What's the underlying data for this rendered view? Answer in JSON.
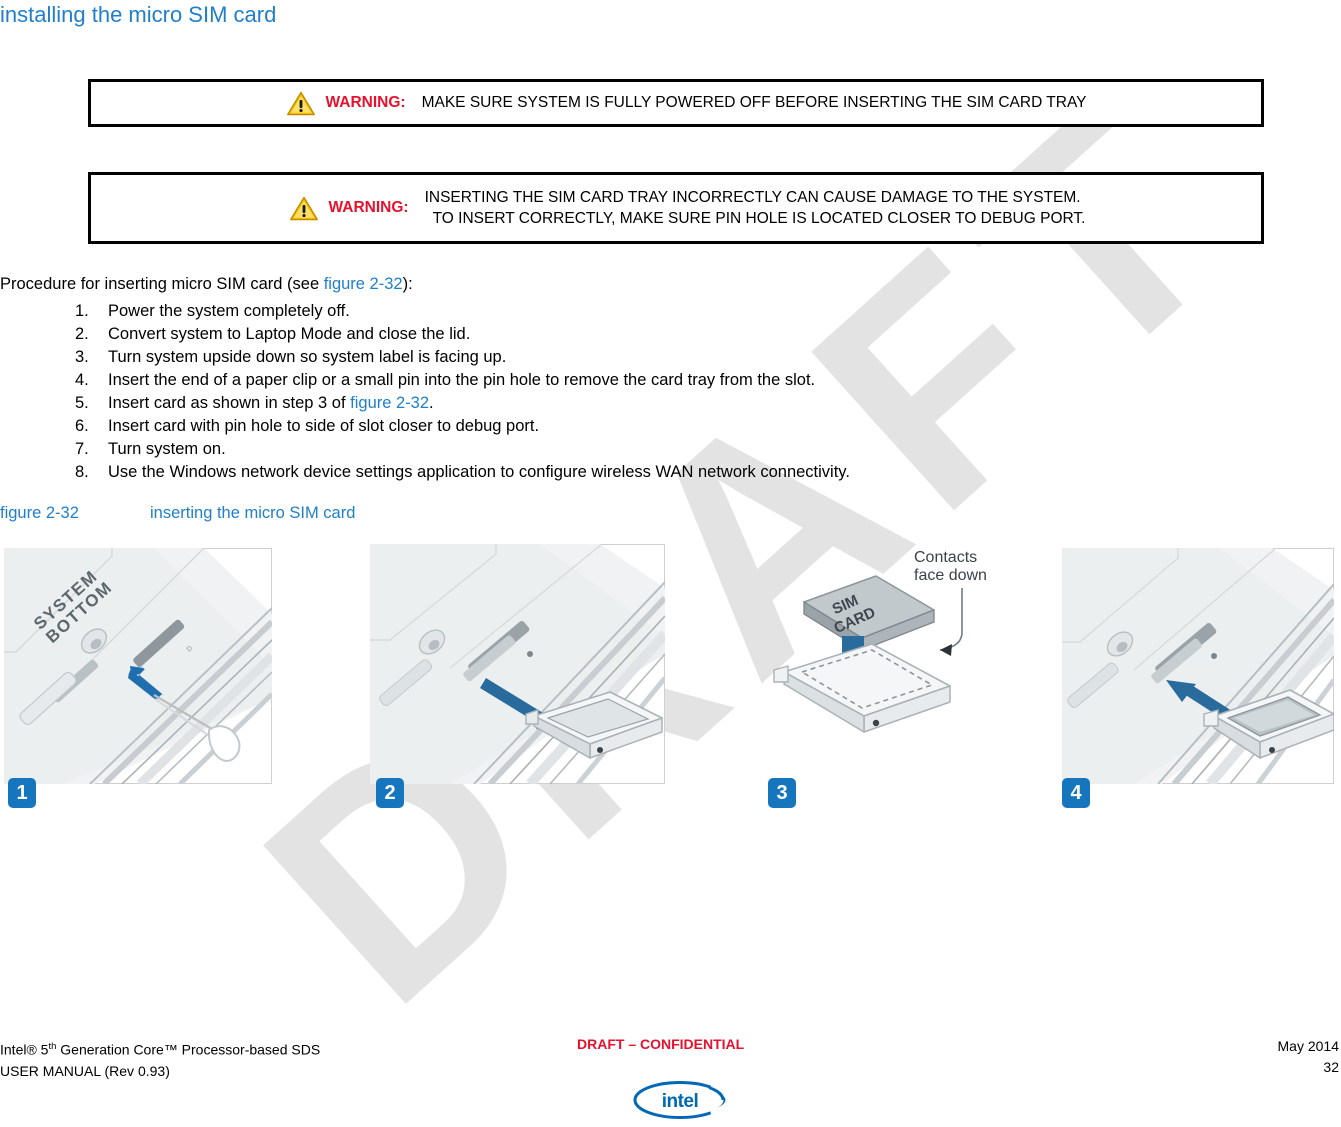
{
  "document": {
    "heading": "installing the micro SIM card",
    "watermark": "DRAFT"
  },
  "warnings": [
    {
      "icon": "warning-triangle-icon",
      "label": "WARNING:",
      "text": "MAKE SURE SYSTEM IS FULLY POWERED OFF BEFORE INSERTING THE SIM CARD TRAY"
    },
    {
      "icon": "warning-triangle-icon",
      "label": "WARNING:",
      "line1": "INSERTING THE SIM CARD TRAY INCORRECTLY CAN CAUSE DAMAGE TO THE SYSTEM.",
      "line2": "TO INSERT CORRECTLY, MAKE SURE PIN HOLE IS LOCATED CLOSER TO DEBUG PORT."
    }
  ],
  "procedure": {
    "intro_prefix": "Procedure for inserting micro SIM card (see ",
    "intro_xref": "figure 2-32",
    "intro_suffix": "):",
    "steps": [
      {
        "num": "1.",
        "text": "Power the system completely off."
      },
      {
        "num": "2.",
        "text": "Convert system to Laptop Mode and close the lid."
      },
      {
        "num": "3.",
        "text": "Turn system upside down so system label is facing up."
      },
      {
        "num": "4.",
        "text": "Insert the end of a paper clip or a small pin into the pin hole to remove the card tray from the slot."
      },
      {
        "num": "5.",
        "text_prefix": "Insert card as shown in step 3 of ",
        "xref": "figure 2-32",
        "text_suffix": "."
      },
      {
        "num": "6.",
        "text": "Insert card with pin hole to side of slot closer to debug port."
      },
      {
        "num": "7.",
        "text": "Turn system on."
      },
      {
        "num": "8.",
        "text": "Use the Windows network device settings application to configure wireless WAN network connectivity."
      }
    ]
  },
  "figure": {
    "number": "figure 2-32",
    "title": "inserting the micro SIM card",
    "panels": [
      {
        "badge": "1",
        "label_top": "SYSTEM",
        "label_bottom": "BOTTOM",
        "alt": "paper clip inserted into pin hole on system bottom"
      },
      {
        "badge": "2",
        "alt": "SIM card tray being ejected from the slot"
      },
      {
        "badge": "3",
        "annotation_line1": "Contacts",
        "annotation_line2": "face down",
        "card_label_top": "SIM",
        "card_label_bottom": "CARD",
        "alt": "SIM card placed into tray with contacts facing down"
      },
      {
        "badge": "4",
        "alt": "tray with SIM card being reinserted into the slot"
      }
    ]
  },
  "footer": {
    "left_line1_prefix": "Intel® 5",
    "left_line1_sup": "th",
    "left_line1_suffix": " Generation Core™ Processor-based SDS",
    "left_line2": "USER MANUAL (Rev 0.93)",
    "center": "DRAFT – CONFIDENTIAL",
    "right_line1": "May 2014",
    "right_line2": "32",
    "logo": "intel-logo"
  },
  "colors": {
    "heading_blue": "#1f7fcb",
    "warning_red": "#e8112d",
    "badge_blue": "#1676bd",
    "watermark_gray": "#e3e3e3",
    "arrow_blue": "#1f6fb0"
  }
}
